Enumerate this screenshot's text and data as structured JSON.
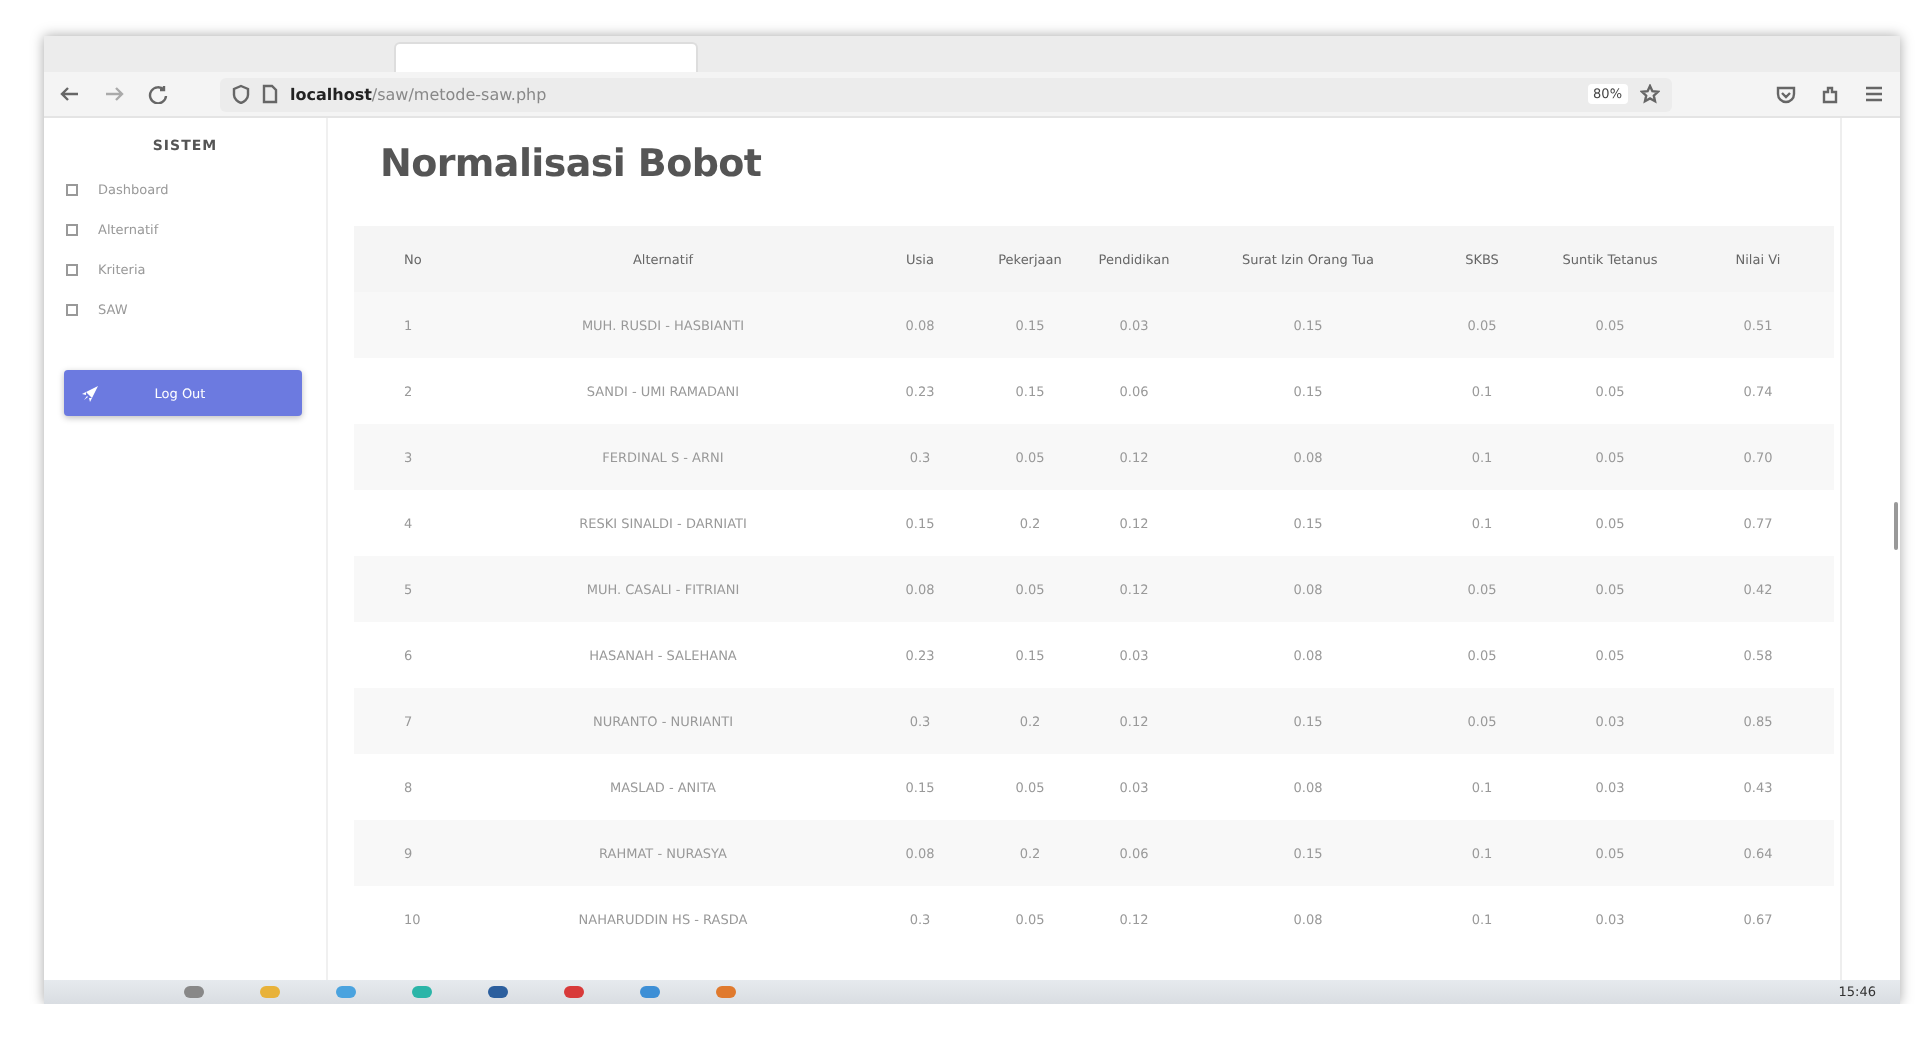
{
  "browser": {
    "address": {
      "host": "localhost",
      "path": "/saw/metode-saw.php"
    },
    "zoom": "80%"
  },
  "sidebar": {
    "heading": "SISTEM",
    "items": [
      {
        "label": "Dashboard"
      },
      {
        "label": "Alternatif"
      },
      {
        "label": "Kriteria"
      },
      {
        "label": "SAW"
      }
    ],
    "logout_button": "Log Out"
  },
  "page": {
    "title": "Normalisasi Bobot"
  },
  "table": {
    "columns": [
      "No",
      "Alternatif",
      "Usia",
      "Pekerjaan",
      "Pendidikan",
      "Surat Izin Orang Tua",
      "SKBS",
      "Suntik Tetanus",
      "Nilai Vi"
    ],
    "rows": [
      [
        "1",
        "MUH. RUSDI - HASBIANTI",
        "0.08",
        "0.15",
        "0.03",
        "0.15",
        "0.05",
        "0.05",
        "0.51"
      ],
      [
        "2",
        "SANDI - UMI RAMADANI",
        "0.23",
        "0.15",
        "0.06",
        "0.15",
        "0.1",
        "0.05",
        "0.74"
      ],
      [
        "3",
        "FERDINAL S - ARNI",
        "0.3",
        "0.05",
        "0.12",
        "0.08",
        "0.1",
        "0.05",
        "0.70"
      ],
      [
        "4",
        "RESKI SINALDI - DARNIATI",
        "0.15",
        "0.2",
        "0.12",
        "0.15",
        "0.1",
        "0.05",
        "0.77"
      ],
      [
        "5",
        "MUH. CASALI - FITRIANI",
        "0.08",
        "0.05",
        "0.12",
        "0.08",
        "0.05",
        "0.05",
        "0.42"
      ],
      [
        "6",
        "HASANAH - SALEHANA",
        "0.23",
        "0.15",
        "0.03",
        "0.08",
        "0.05",
        "0.05",
        "0.58"
      ],
      [
        "7",
        "NURANTO - NURIANTI",
        "0.3",
        "0.2",
        "0.12",
        "0.15",
        "0.05",
        "0.03",
        "0.85"
      ],
      [
        "8",
        "MASLAD - ANITA",
        "0.15",
        "0.05",
        "0.03",
        "0.08",
        "0.1",
        "0.03",
        "0.43"
      ],
      [
        "9",
        "RAHMAT - NURASYA",
        "0.08",
        "0.2",
        "0.06",
        "0.15",
        "0.1",
        "0.05",
        "0.64"
      ],
      [
        "10",
        "NAHARUDDIN HS - RASDA",
        "0.3",
        "0.05",
        "0.12",
        "0.08",
        "0.1",
        "0.03",
        "0.67"
      ]
    ]
  },
  "taskbar": {
    "time": "15:46"
  }
}
